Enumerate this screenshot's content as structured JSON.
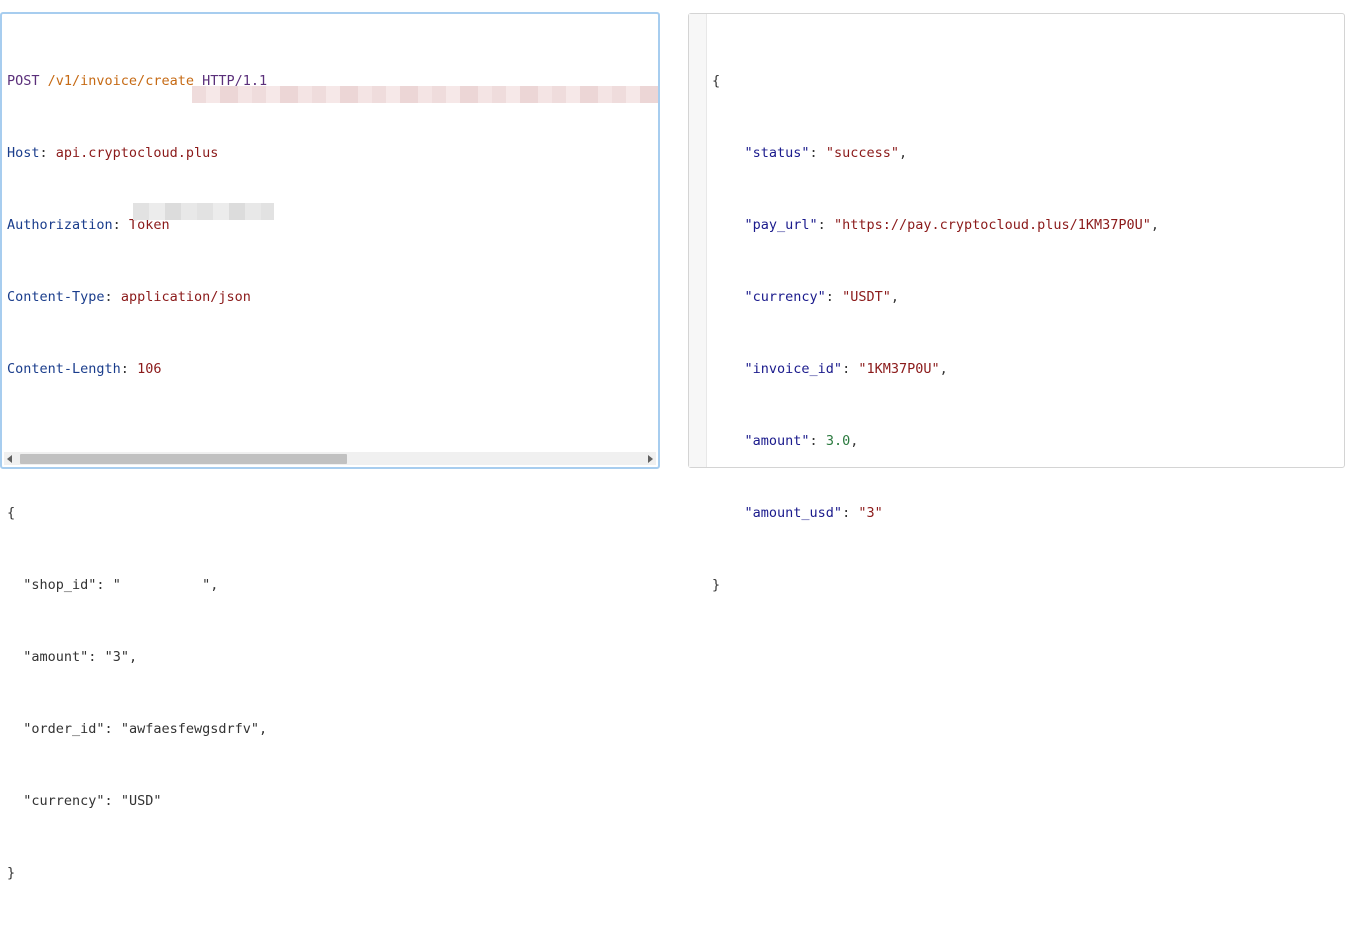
{
  "request": {
    "method": "POST",
    "path": "/v1/invoice/create",
    "protocol": "HTTP/1.1",
    "headers": [
      {
        "name": "Host",
        "value": "api.cryptocloud.plus"
      },
      {
        "name": "Authorization",
        "value": "Token"
      },
      {
        "name": "Content-Type",
        "value": "application/json"
      },
      {
        "name": "Content-Length",
        "value": "106"
      }
    ],
    "body_open": "{",
    "body_close": "}",
    "body": [
      {
        "key": "\"shop_id\"",
        "value": "\"          \"",
        "redacted": true
      },
      {
        "key": "\"amount\"",
        "value": "\"3\""
      },
      {
        "key": "\"order_id\"",
        "value": "\"awfaesfewgsdrfv\""
      },
      {
        "key": "\"currency\"",
        "value": "\"USD\""
      }
    ]
  },
  "response": {
    "open": "{",
    "close": "}",
    "fields": [
      {
        "key": "\"status\"",
        "value": "\"success\"",
        "type": "string"
      },
      {
        "key": "\"pay_url\"",
        "value": "\"https://pay.cryptocloud.plus/1KM37P0U\"",
        "type": "string"
      },
      {
        "key": "\"currency\"",
        "value": "\"USDT\"",
        "type": "string"
      },
      {
        "key": "\"invoice_id\"",
        "value": "\"1KM37P0U\"",
        "type": "string"
      },
      {
        "key": "\"amount\"",
        "value": "3.0",
        "type": "number"
      },
      {
        "key": "\"amount_usd\"",
        "value": "\"3\"",
        "type": "string"
      }
    ]
  },
  "colors": {
    "focus_border": "#a7cdef",
    "method": "#5a2f7a",
    "path": "#c66a14",
    "header_name": "#1a3d8c",
    "string": "#8b1a1a",
    "number": "#2b7a3f"
  }
}
